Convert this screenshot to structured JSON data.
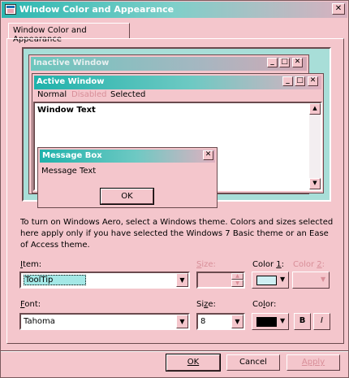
{
  "window": {
    "title": "Window Color and Appearance",
    "close_glyph": "✕"
  },
  "tab": {
    "label": "Window Color and Appearance"
  },
  "preview": {
    "inactive_title": "Inactive Window",
    "active_title": "Active Window",
    "menu": {
      "normal": "Normal",
      "disabled": "Disabled",
      "selected": "Selected"
    },
    "window_text": "Window Text",
    "message_box": {
      "title": "Message Box",
      "text": "Message Text",
      "ok": "OK"
    },
    "caption_glyphs": {
      "minimize": "_",
      "maximize": "□",
      "close": "✕"
    }
  },
  "info_text": "To turn on Windows Aero, select a Windows theme.  Colors and sizes selected here apply only if you have selected the Windows 7 Basic theme or an Ease of Access theme.",
  "item": {
    "label_key": "I",
    "label_rest": "tem:",
    "value": "ToolTip"
  },
  "item_size": {
    "label_key": "S",
    "label_rest": "ize:",
    "value": ""
  },
  "color1": {
    "label_pre": "Color ",
    "label_key": "1",
    "label_post": ":",
    "swatch": "#cfeff3"
  },
  "color2": {
    "label_pre": "Color ",
    "label_key": "2",
    "label_post": ":"
  },
  "font": {
    "label_key": "F",
    "label_rest": "ont:",
    "value": "Tahoma"
  },
  "font_size": {
    "label_pre": "Si",
    "label_key": "z",
    "label_post": "e:",
    "value": "8"
  },
  "font_color": {
    "label_pre": "Co",
    "label_key": "l",
    "label_post": "or:",
    "swatch": "#000000"
  },
  "bold_label": "B",
  "italic_label": "I",
  "buttons": {
    "ok": "OK",
    "cancel": "Cancel",
    "apply": "Apply"
  },
  "colors": {
    "accent": "#2bb7b0",
    "face": "#f4c6cc",
    "disabled_text": "#d88e98",
    "preview_bg": "#a8ded8"
  }
}
